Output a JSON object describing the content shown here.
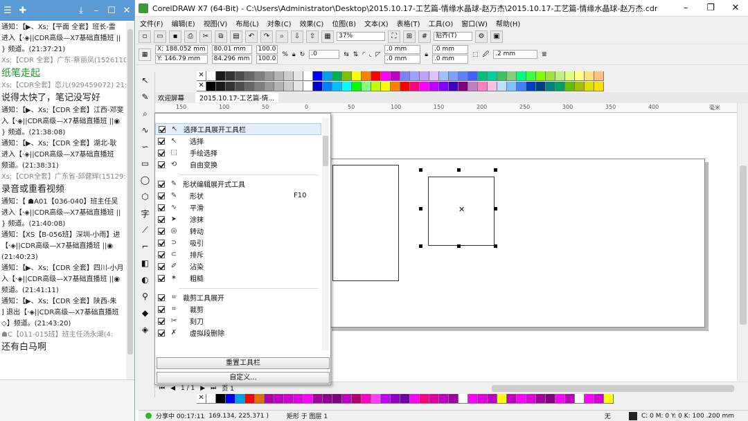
{
  "chat": {
    "messages": [
      {
        "text": "通知：【▶、Xs;【平面 全套】班长-雷",
        "style": "normal"
      },
      {
        "text": "进入【·◈||CDR高级—X7基础直播班 ||",
        "style": "normal"
      },
      {
        "text": "} 频道。(21:37:21)",
        "style": "normal"
      },
      {
        "text": "Xs;【CDR 全套】广东-蔡丽凤(1526110",
        "style": "gray"
      },
      {
        "text": "纸笔走起",
        "style": "green"
      },
      {
        "text": "Xs;【CDR全套】恋儿(929459072) 21:3",
        "style": "gray"
      },
      {
        "text": "说得太快了，笔记没写好",
        "style": "big"
      },
      {
        "text": "通知：【▶、Xs;【CDR 全套】江西-邓斐",
        "style": "normal"
      },
      {
        "text": "入【·◈||CDR高级—X7基础直播班 ||◉",
        "style": "normal"
      },
      {
        "text": "} 频道。(21:38:08)",
        "style": "normal"
      },
      {
        "text": "通知：【▶、Xs;【CDR 全套】湖北-耿",
        "style": "normal"
      },
      {
        "text": "进入【·◈||CDR高级—X7基础直播班",
        "style": "normal"
      },
      {
        "text": "频道。(21:38:31)",
        "style": "normal"
      },
      {
        "text": "Xs;【CDR全套】广东省-邱健辉(15129:",
        "style": "gray"
      },
      {
        "text": "录音或重看视频",
        "style": "big"
      },
      {
        "text": "通知：【  ☗A01【036-040】班主任吴",
        "style": "normal"
      },
      {
        "text": "进入【·◈||CDR高级—X7基础直播班 ||",
        "style": "normal"
      },
      {
        "text": "} 频道。(21:40:08)",
        "style": "normal"
      },
      {
        "text": "通知：【XS【B-056班】深圳-小雨】进",
        "style": "normal"
      },
      {
        "text": "【·◈||CDR高级—X7基础直播班 ||◉",
        "style": "normal"
      },
      {
        "text": "(21:40:23)",
        "style": "normal"
      },
      {
        "text": "通知：【▶、Xs;【CDR 全套】四川-小月",
        "style": "normal"
      },
      {
        "text": "入【·◈||CDR高级—X7基础直播班 ||◉",
        "style": "normal"
      },
      {
        "text": "频道。(21:41:11)",
        "style": "normal"
      },
      {
        "text": "通知：【▶、Xs;【CDR 全套】陕西-朱",
        "style": "normal"
      },
      {
        "text": "] 退出【·◈||CDR高级—X7基础直播班",
        "style": "normal"
      },
      {
        "text": "◇】频道。(21:43:20)",
        "style": "normal"
      },
      {
        "text": "☗C【011-015班】班主任汤永潮(4:",
        "style": "gray"
      },
      {
        "text": "还有白马啊",
        "style": "big"
      }
    ]
  },
  "app": {
    "title": "CorelDRAW X7 (64-Bit) - C:\\Users\\Administrator\\Desktop\\2015.10.17-工艺篇-情缘水晶球-赵万杰\\2015.10.17-工艺篇-情缘水晶球-赵万杰.cdr",
    "menu": [
      "文件(F)",
      "编辑(E)",
      "视图(V)",
      "布局(L)",
      "对象(C)",
      "效果(C)",
      "位图(B)",
      "文本(X)",
      "表格(T)",
      "工具(O)",
      "窗口(W)",
      "帮助(H)"
    ],
    "zoom": "37%",
    "snap": "贴齐(T)",
    "props": {
      "x": "X: 188.052 mm",
      "y": "Y: 146.79 mm",
      "w": "80.01 mm",
      "h": "84.296 mm",
      "sx": "100.0",
      "sy": "100.0",
      "pct": "%",
      "rot": ".0",
      "corner1": ".0 mm",
      "corner2": ".0 mm",
      "corner3": ".0 mm",
      "corner4": ".0 mm",
      "outline": ".2 mm"
    },
    "tabs": {
      "welcome": "欢迎屏幕",
      "doc": "2015.10.17-工艺篇-情..."
    },
    "ruler": [
      "150",
      "100",
      "50",
      "0",
      "50",
      "100",
      "150",
      "200",
      "250",
      "300",
      "350",
      "400",
      "毫米"
    ],
    "page": {
      "count": "1 / 1",
      "label": "页 1"
    },
    "status": {
      "coords": "169.134, 225.371 )",
      "obj": "矩形 于 图层 1",
      "fill": "无",
      "outline": "C: 0 M: 0 Y: 0 K: 100  .200 mm",
      "live": "分享中 00:17:11"
    }
  },
  "flyout": {
    "sections": [
      {
        "label": "选择工具展开工具栏",
        "icon": "↖",
        "selected": true,
        "items": [
          {
            "label": "选择",
            "icon": "↖",
            "key": ""
          },
          {
            "label": "手绘选择",
            "icon": "⬚",
            "key": ""
          },
          {
            "label": "自由变换",
            "icon": "⟲",
            "key": ""
          }
        ]
      },
      {
        "label": "形状编辑展开式工具",
        "icon": "✎",
        "items": [
          {
            "label": "形状",
            "icon": "✎",
            "key": "F10"
          },
          {
            "label": "平滑",
            "icon": "∿",
            "key": ""
          },
          {
            "label": "涂抹",
            "icon": "➤",
            "key": ""
          },
          {
            "label": "转动",
            "icon": "◎",
            "key": ""
          },
          {
            "label": "吸引",
            "icon": "⊃",
            "key": ""
          },
          {
            "label": "排斥",
            "icon": "⊂",
            "key": ""
          },
          {
            "label": "沾染",
            "icon": "✐",
            "key": ""
          },
          {
            "label": "粗糙",
            "icon": "✶",
            "key": ""
          }
        ]
      },
      {
        "label": "裁剪工具展开",
        "icon": "⌗",
        "items": [
          {
            "label": "裁剪",
            "icon": "⌗",
            "key": ""
          },
          {
            "label": "刻刀",
            "icon": "✂",
            "key": ""
          },
          {
            "label": "虚拟段删除",
            "icon": "✗",
            "key": ""
          }
        ]
      }
    ],
    "reset_label": "重置工具栏",
    "custom_label": "自定义..."
  },
  "colors": {
    "palette_top1": [
      "#ffffff",
      "#1a1a1a",
      "#333333",
      "#4d4d4d",
      "#666666",
      "#808080",
      "#999999",
      "#b3b3b3",
      "#cccccc",
      "#e6e6e6",
      "#ffffff",
      "#0000ff",
      "#00a0e9",
      "#00b050",
      "#80c000",
      "#ffff00",
      "#ff8000",
      "#ff0000",
      "#ff00ff",
      "#c000c0",
      "#8080ff",
      "#9fa0ff",
      "#c0a0ff",
      "#e0c0ff",
      "#a0c0ff",
      "#80a0ff",
      "#6080ff",
      "#4060ff",
      "#00c080",
      "#00d0a0",
      "#40c060",
      "#80d080",
      "#00ff80",
      "#40ff40",
      "#80ff00",
      "#a0e040",
      "#c0f080",
      "#e0ff80",
      "#ffff80",
      "#ffe080",
      "#ffc080"
    ],
    "palette_top2": [
      "#000000",
      "#1a1a1a",
      "#333333",
      "#4d4d4d",
      "#666666",
      "#808080",
      "#999999",
      "#b3b3b3",
      "#cccccc",
      "#e6e6e6",
      "#ffffff",
      "#0000cc",
      "#0080ff",
      "#00c0ff",
      "#00ffff",
      "#00ff00",
      "#80ff80",
      "#c0ff00",
      "#ffff00",
      "#ff8000",
      "#ff0000",
      "#ff0080",
      "#ff00ff",
      "#c000ff",
      "#8000ff",
      "#4000c0",
      "#800080",
      "#c080c0",
      "#ff80c0",
      "#ffc0e0",
      "#c0e0ff",
      "#80c0ff",
      "#4080ff",
      "#0040c0",
      "#004080",
      "#008080",
      "#00a060",
      "#60c000",
      "#a0c000",
      "#e0e000",
      "#ffe000"
    ],
    "palette_bottom": [
      "#ffffff",
      "#000000",
      "#0000ff",
      "#00a0e9",
      "#ff0000",
      "#e07000",
      "#b000b0",
      "#c000c0",
      "#d000d0",
      "#e000e0",
      "#ff00ff",
      "#a000a0",
      "#900090",
      "#800080",
      "#c000c0",
      "#b00070",
      "#ff00c0",
      "#ff40ff",
      "#c000ff",
      "#9000c0",
      "#7000a0",
      "#ff00ff",
      "#ff0080",
      "#e000a0",
      "#c000c0",
      "#a000a0",
      "#ffffff",
      "#ff00ff",
      "#e000e0",
      "#c000c0",
      "#ffff00",
      "#c000c0",
      "#ff00ff",
      "#e000e0",
      "#a000a0",
      "#800080",
      "#ff00ff",
      "#c000c0",
      "#ffffff",
      "#ff00ff",
      "#d000d0",
      "#ffff00"
    ]
  }
}
